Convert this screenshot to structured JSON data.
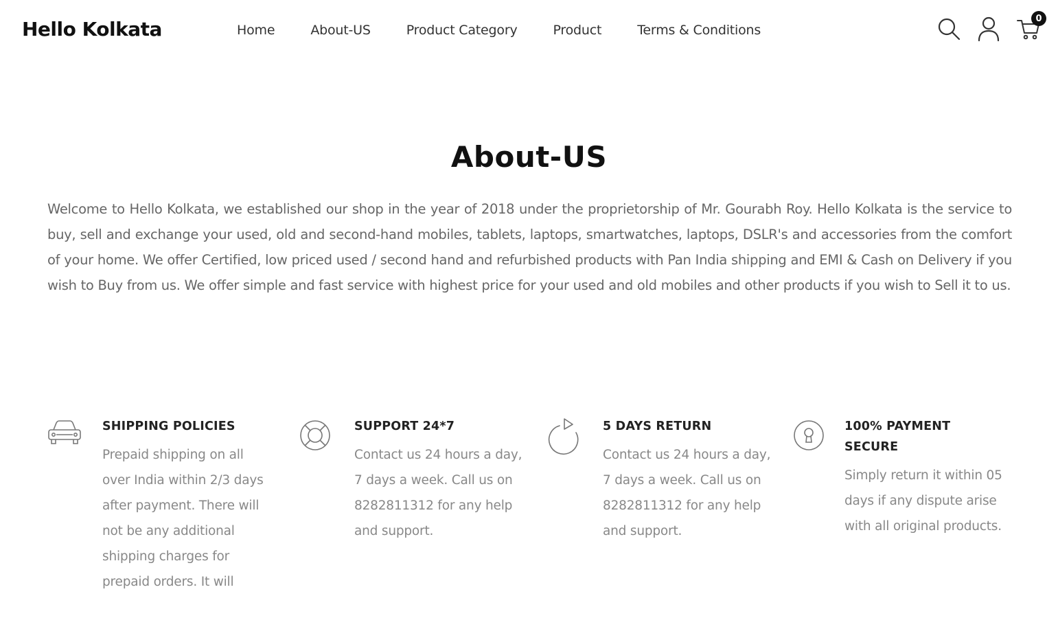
{
  "header": {
    "logo": "Hello Kolkata",
    "nav": [
      {
        "label": "Home"
      },
      {
        "label": "About-US"
      },
      {
        "label": "Product Category"
      },
      {
        "label": "Product"
      },
      {
        "label": "Terms & Conditions"
      }
    ],
    "icons": {
      "search": "search-icon",
      "account": "user-icon",
      "cart": "cart-icon"
    },
    "cart_count": "0"
  },
  "main": {
    "title": "About-US",
    "intro": "Welcome to Hello Kolkata, we established our shop in the year of 2018 under the proprietorship of Mr. Gourabh Roy. Hello Kolkata is the service to buy, sell and exchange your used, old and second-hand mobiles, tablets, laptops, smartwatches, laptops, DSLR's and accessories from the comfort of your home. We offer Certified, low priced used / second hand and refurbished products with Pan India shipping and EMI & Cash on Delivery if you wish to Buy from us. We offer simple and fast service with highest price for your used and old mobiles and other products if you wish to Sell it to us."
  },
  "features": [
    {
      "icon": "car-icon",
      "title": "SHIPPING POLICIES",
      "text": "Prepaid shipping on all over India within 2/3 days after payment. There will not be any additional shipping charges for prepaid orders. It will"
    },
    {
      "icon": "lifebuoy-icon",
      "title": "SUPPORT 24*7",
      "text": "Contact us 24 hours a day, 7 days a week. Call us on 8282811312 for any help and support."
    },
    {
      "icon": "refresh-icon",
      "title": "5 DAYS RETURN",
      "text": "Contact us 24 hours a day, 7 days a week. Call us on 8282811312 for any help and support."
    },
    {
      "icon": "secure-payment-icon",
      "title": "100% PAYMENT SECURE",
      "text": "Simply return it within 05 days if any dispute arise with all original products."
    }
  ],
  "colors": {
    "text_dark": "#111111",
    "text_body": "#666666",
    "text_muted": "#888888",
    "badge": "#111111"
  }
}
